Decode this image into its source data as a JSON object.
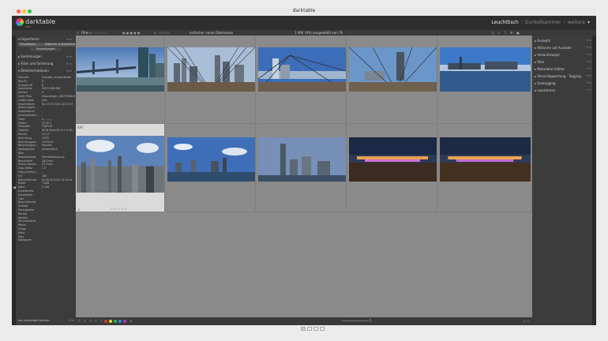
{
  "window": {
    "title": "darktable"
  },
  "app": {
    "name": "darktable",
    "version": "4.8.1"
  },
  "views": {
    "active": "Leuchttisch",
    "other": "Dunkelkammer",
    "more": "weitere"
  },
  "topbar": {
    "filter_label": "Filter",
    "search_placeholder": "suchen",
    "sort_label": "einfacher name",
    "sort_order": "Dateiname",
    "count": "1 904 (#0) ausgewählt von 76"
  },
  "left": {
    "modules": [
      {
        "label": "Importieren"
      },
      {
        "label": "Sammlungen"
      },
      {
        "label": "Filter und Sortierung"
      },
      {
        "label": "Bildinformationen"
      }
    ],
    "import_buttons": [
      "Hinzufügen...",
      "kopieren & importieren..."
    ],
    "import_sub": "Einstellungen",
    "metadata": [
      [
        "Filmrolle",
        "Urlauber_umgearbeitet"
      ],
      [
        "Bild-ID",
        "8"
      ],
      [
        "Gruppen-ID",
        "8"
      ],
      [
        "Dateiname",
        "DSCF0366.RAF"
      ],
      [
        "Version",
        "0"
      ],
      [
        "Voller Pfad",
        "/Users/Inger...DSCF0366.RAF"
      ],
      [
        "Lokale Kopie",
        "nein"
      ],
      [
        "Importdatum",
        "Do 17.03.2024 16:13:19"
      ],
      [
        "Änderungsze...",
        "-"
      ],
      [
        "Exportdatum",
        "-"
      ],
      [
        "Druckzeitstem...",
        "-"
      ],
      [
        "Flags",
        "0,-,-,-,-,-"
      ],
      [
        "Modell",
        "X-T30 II"
      ],
      [
        "Hersteller",
        "FUJIFILM"
      ],
      [
        "Objektiv",
        "XF18-55mmF2.8-4 R LM..."
      ],
      [
        "Blende",
        "f/11.0"
      ],
      [
        "Belichtung",
        "1/125"
      ],
      [
        "Belichtungsze...",
        "14.05.03"
      ],
      [
        "Belichtungspr...",
        "Manuell"
      ],
      [
        "Weißabgleich",
        "Automatisch"
      ],
      [
        "Blitz",
        "-"
      ],
      [
        "Messmethode",
        "Mehrfeldmessung"
      ],
      [
        "Brennweite",
        "18.0 mm"
      ],
      [
        "35mm Äquiva...",
        "27.0 mm"
      ],
      [
        "Crop-Faktor",
        "1.5"
      ],
      [
        "Fokus-Entfern...",
        "-"
      ],
      [
        "ISO",
        "160"
      ],
      [
        "Datum/Uhrzeit",
        "So 08.05.2024 14:18:04"
      ],
      [
        "Breite",
        "7 808"
      ],
      [
        "Höhe",
        "5 184"
      ],
      [
        "Exportbreite",
        "-"
      ],
      [
        "Exporthöhe",
        "-"
      ],
      [
        "Titel",
        "-"
      ],
      [
        "Beschreibung",
        "-"
      ],
      [
        "Urheber",
        "-"
      ],
      [
        "Herausgeber",
        "-"
      ],
      [
        "Rechte",
        "-"
      ],
      [
        "Notizen",
        "-"
      ],
      [
        "Versionsname",
        "-"
      ],
      [
        "Breite",
        "-"
      ],
      [
        "Länge",
        "-"
      ],
      [
        "Höhe",
        "-"
      ],
      [
        "Tags",
        "-"
      ],
      [
        "Kategorien",
        "-"
      ]
    ],
    "bottom_label": "aus schneiden löschen"
  },
  "right": {
    "modules": [
      "Auswahl",
      "Aktionen auf Auswahl",
      "Verlaufsstapel",
      "Stile",
      "Metadaten-Editor",
      "Verschlagwortung - Tagging",
      "Geotagging",
      "exportieren"
    ]
  },
  "grid": {
    "highlight_label": "RAF",
    "stars": "☆☆☆☆☆",
    "reject": "⊘"
  },
  "bottombar": {
    "stars": "☆ ☆ ☆ ☆ ☆"
  },
  "colors": {
    "labels": [
      "#d33",
      "#dd3",
      "#3b3",
      "#38d",
      "#b3b"
    ]
  }
}
